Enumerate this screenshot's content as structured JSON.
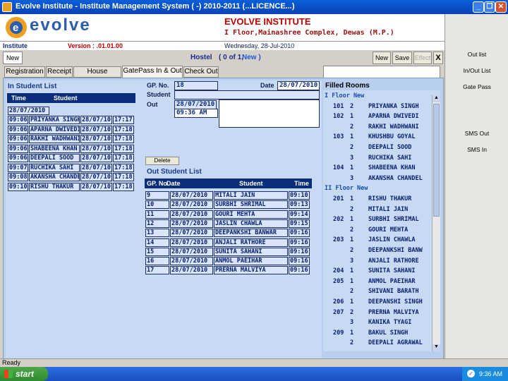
{
  "window": {
    "title": "Evolve Institute - Institute Management System ( -) 2010-2011 (...LICENCE...)"
  },
  "header": {
    "logo_text": "evolve",
    "inst_name": "EVOLVE INSTITUTE",
    "inst_addr": "I Floor,Mainashree Complex, Dewas (M.P.)"
  },
  "infobar": {
    "left": "Institute",
    "version": "Version : .01.01.00",
    "date": "Wednesday, 28-Jul-2010"
  },
  "toolbar": {
    "new_tab": "New",
    "module": "Hostel",
    "record": "( 0 of 1,",
    "record_new": "New )",
    "new": "New",
    "save": "Save",
    "effect": "Effect",
    "close": "X"
  },
  "tabs": [
    "Registration",
    "Receipt",
    "House Keeping",
    "GatePass In & Out",
    "Check Out"
  ],
  "in_list": {
    "title": "In Student List",
    "col_time": "Time",
    "col_student": "Student",
    "date": "28/07/2010",
    "rows": [
      {
        "time": "09:06",
        "name": "PRIYANKA SINGH",
        "date": "28/07/10",
        "out": "17:17"
      },
      {
        "time": "09:06",
        "name": "APARNA DWIVEDI",
        "date": "28/07/10",
        "out": "17:18"
      },
      {
        "time": "09:06",
        "name": "RAKHI WADHWANI",
        "date": "28/07/10",
        "out": "17:18"
      },
      {
        "time": "09:06",
        "name": "SHABEENA KHAN",
        "date": "28/07/10",
        "out": "17:18"
      },
      {
        "time": "09:06",
        "name": "DEEPALI SOOD",
        "date": "28/07/10",
        "out": "17:18"
      },
      {
        "time": "09:07",
        "name": "RUCHIKA SAHI",
        "date": "28/07/10",
        "out": "17:18"
      },
      {
        "time": "09:08",
        "name": "AKANSHA CHANDEL",
        "date": "28/07/10",
        "out": "17:18"
      },
      {
        "time": "09:10",
        "name": "RISHU THAKUR",
        "date": "28/07/10",
        "out": "17:18"
      }
    ]
  },
  "form": {
    "gp_label": "GP. No.",
    "gp_value": "18",
    "date_label": "Date",
    "date_value": "28/07/2010",
    "student_label": "Student",
    "student_value": "",
    "out_label": "Out",
    "out_date": "28/07/2010",
    "out_time": "09:36 AM",
    "delete": "Delete"
  },
  "out_list": {
    "title": "Out Student List",
    "col_gp": "GP. No.",
    "col_date": "Date",
    "col_student": "Student",
    "col_time": "Time",
    "rows": [
      {
        "gp": "9",
        "date": "28/07/2010",
        "name": "MITALI JAIN",
        "time": "09:10"
      },
      {
        "gp": "10",
        "date": "28/07/2010",
        "name": "SURBHI SHRIMAL",
        "time": "09:13"
      },
      {
        "gp": "11",
        "date": "28/07/2010",
        "name": "GOURI MEHTA",
        "time": "09:14"
      },
      {
        "gp": "12",
        "date": "28/07/2010",
        "name": "JASLIN CHAWLA",
        "time": "09:15"
      },
      {
        "gp": "13",
        "date": "28/07/2010",
        "name": "DEEPANKSHI BANWAR",
        "time": "09:16"
      },
      {
        "gp": "14",
        "date": "28/07/2010",
        "name": "ANJALI RATHORE",
        "time": "09:16"
      },
      {
        "gp": "15",
        "date": "28/07/2010",
        "name": "SUNITA SAHANI",
        "time": "09:16"
      },
      {
        "gp": "16",
        "date": "28/07/2010",
        "name": "ANMOL PAEIHAR",
        "time": "09:16"
      },
      {
        "gp": "17",
        "date": "28/07/2010",
        "name": "PRERNA MALVIYA",
        "time": "09:16"
      }
    ]
  },
  "rooms": {
    "title": "Filled Rooms",
    "lines": [
      {
        "k": "floor",
        "t": "I Floor New"
      },
      {
        "room": "101",
        "bed": "2",
        "name": "PRIYANKA SINGH"
      },
      {
        "room": "102",
        "bed": "1",
        "name": "APARNA DWIVEDI"
      },
      {
        "room": "",
        "bed": "2",
        "name": "RAKHI WADHWANI"
      },
      {
        "room": "103",
        "bed": "1",
        "name": "KHUSHBU GOYAL"
      },
      {
        "room": "",
        "bed": "2",
        "name": "DEEPALI SOOD"
      },
      {
        "room": "",
        "bed": "3",
        "name": "RUCHIKA SAHI"
      },
      {
        "room": "104",
        "bed": "1",
        "name": "SHABEENA KHAN"
      },
      {
        "room": "",
        "bed": "3",
        "name": "AKANSHA CHANDEL"
      },
      {
        "k": "floor",
        "t": "II Floor New"
      },
      {
        "room": "201",
        "bed": "1",
        "name": "RISHU THAKUR"
      },
      {
        "room": "",
        "bed": "2",
        "name": "MITALI JAIN"
      },
      {
        "room": "202",
        "bed": "1",
        "name": "SURBHI SHRIMAL"
      },
      {
        "room": "",
        "bed": "2",
        "name": "GOURI MEHTA"
      },
      {
        "room": "203",
        "bed": "1",
        "name": "JASLIN CHAWLA"
      },
      {
        "room": "",
        "bed": "2",
        "name": "DEEPANKSHI BANW"
      },
      {
        "room": "",
        "bed": "3",
        "name": "ANJALI RATHORE"
      },
      {
        "room": "204",
        "bed": "1",
        "name": "SUNITA SAHANI"
      },
      {
        "room": "205",
        "bed": "1",
        "name": "ANMOL PAEIHAR"
      },
      {
        "room": "",
        "bed": "2",
        "name": "SHIVANI BARATH"
      },
      {
        "room": "206",
        "bed": "1",
        "name": "DEEPANSHI SINGH"
      },
      {
        "room": "207",
        "bed": "2",
        "name": "PRERNA MALVIYA"
      },
      {
        "room": "",
        "bed": "3",
        "name": "KANIKA TYAGI"
      },
      {
        "room": "209",
        "bed": "1",
        "name": "BAKUL SINGH"
      },
      {
        "room": "",
        "bed": "2",
        "name": "DEEPALI AGRAWAL"
      }
    ]
  },
  "sidebar": [
    "Out list",
    "In/Out List",
    "Gate Pass",
    "SMS Out",
    "SMS In"
  ],
  "status": "Ready",
  "taskbar": {
    "start": "start",
    "time": "9:36 AM"
  }
}
